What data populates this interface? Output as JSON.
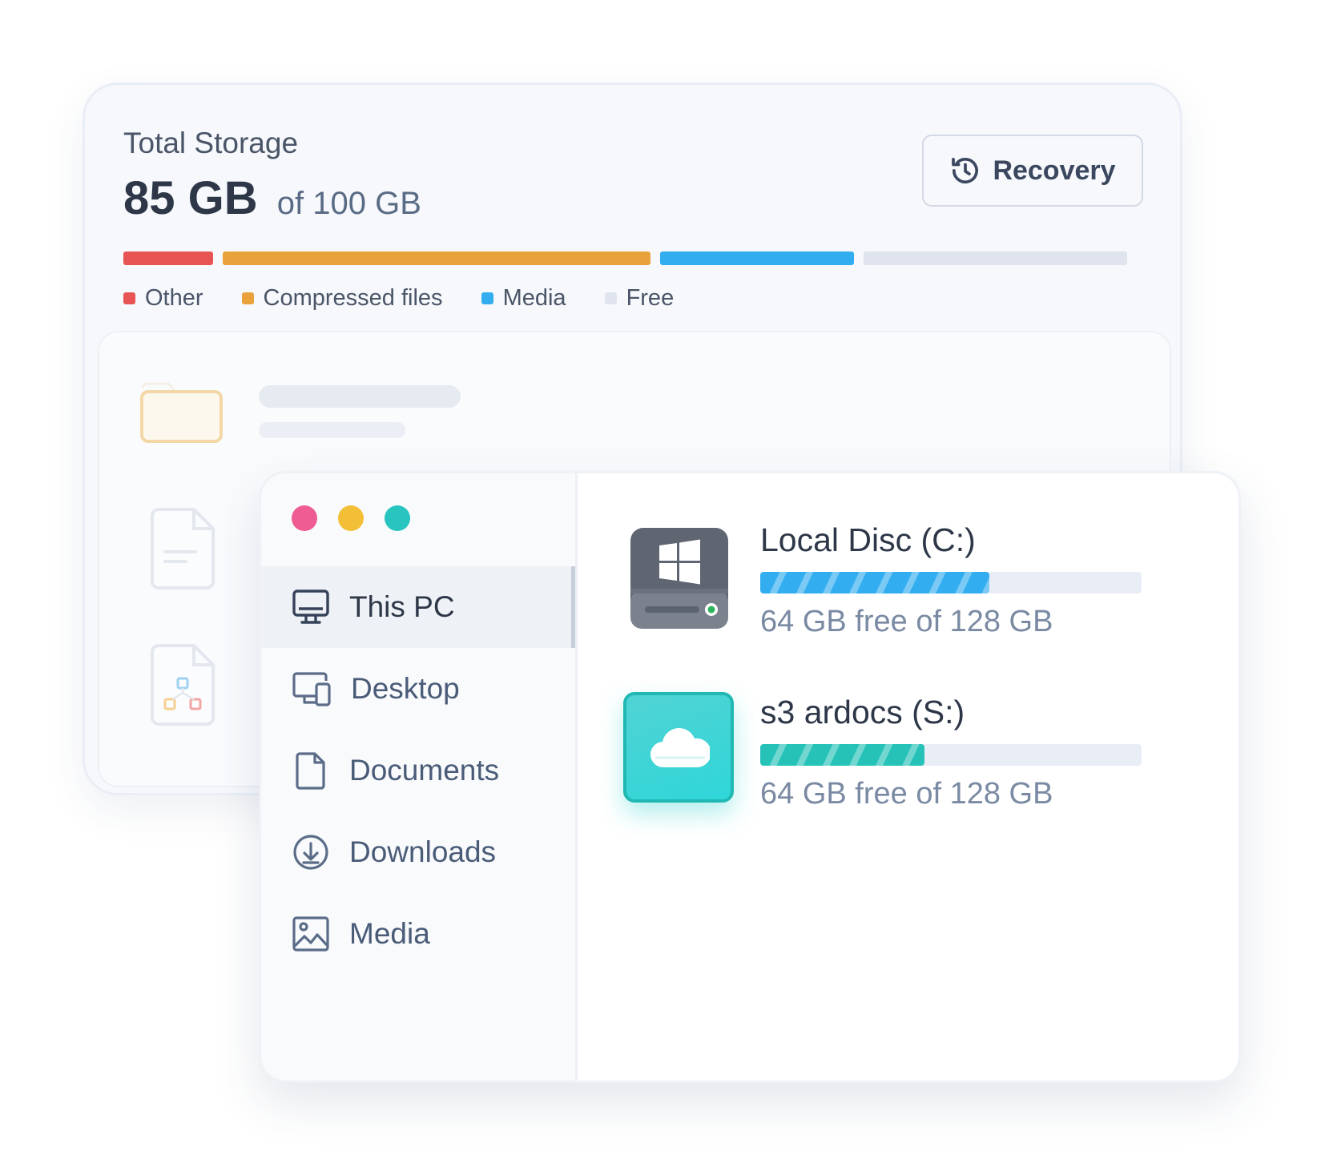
{
  "storage": {
    "title": "Total Storage",
    "used": "85 GB",
    "of_total": "of 100 GB",
    "recovery_label": "Recovery",
    "segments": [
      {
        "name": "Other",
        "color": "#e85454",
        "fraction": 0.09
      },
      {
        "name": "Compressed files",
        "color": "#e9a23b",
        "fraction": 0.43
      },
      {
        "name": "Media",
        "color": "#32aef0",
        "fraction": 0.195
      },
      {
        "name": "Free",
        "color": "#dfe4ef",
        "fraction": 0.265
      }
    ],
    "legend": [
      {
        "label": "Other",
        "color": "#e85454"
      },
      {
        "label": "Compressed files",
        "color": "#e9a23b"
      },
      {
        "label": "Media",
        "color": "#32aef0"
      },
      {
        "label": "Free",
        "color": "#dfe4ef"
      }
    ]
  },
  "window": {
    "traffic_colors": [
      "#ef5b93",
      "#f2bf37",
      "#27c4c0"
    ],
    "nav": [
      {
        "label": "This PC",
        "icon": "monitor-icon",
        "active": true
      },
      {
        "label": "Desktop",
        "icon": "devices-icon",
        "active": false
      },
      {
        "label": "Documents",
        "icon": "document-icon",
        "active": false
      },
      {
        "label": "Downloads",
        "icon": "download-icon",
        "active": false
      },
      {
        "label": "Media",
        "icon": "image-icon",
        "active": false
      }
    ],
    "drives": [
      {
        "name": "Local Disc (C:)",
        "free_text": "64 GB free of 128 GB",
        "used_fraction": 0.6,
        "icon": "windows-drive-icon",
        "bar_color": "#32aef0"
      },
      {
        "name": "s3 ardocs (S:)",
        "free_text": "64 GB free of 128 GB",
        "used_fraction": 0.43,
        "icon": "cloud-drive-icon",
        "bar_color": "#26c2b8"
      }
    ]
  }
}
